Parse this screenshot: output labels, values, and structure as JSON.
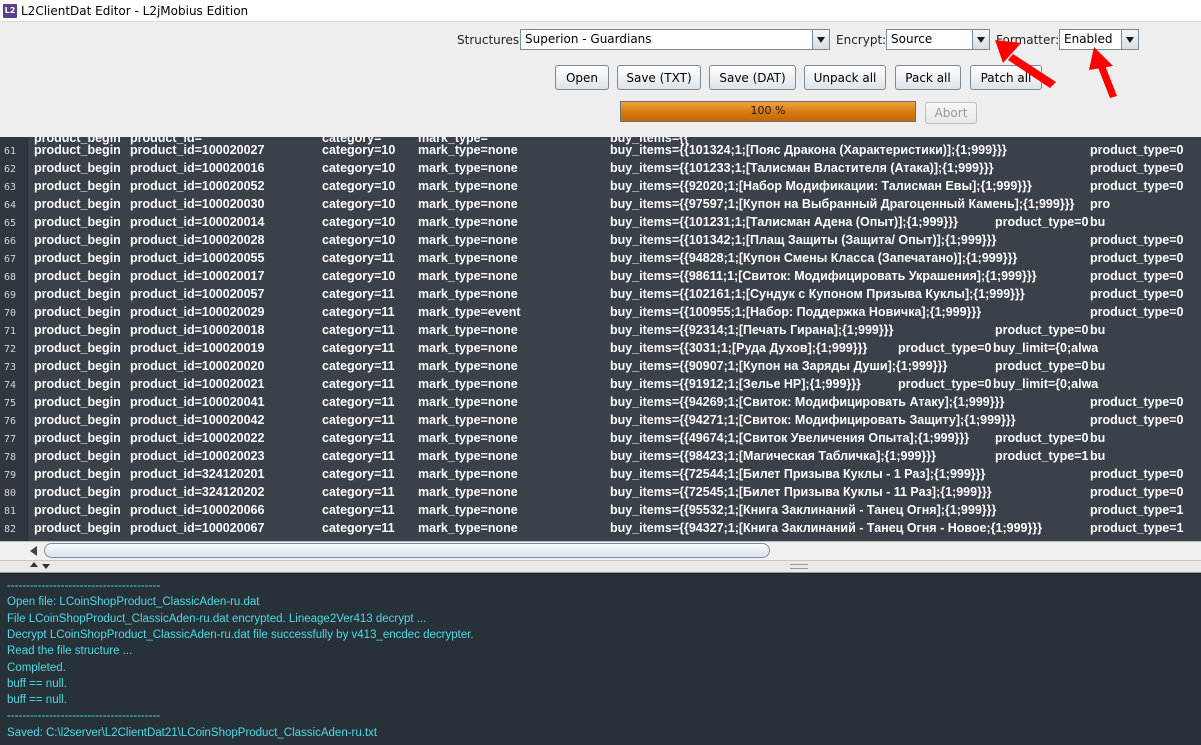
{
  "window": {
    "title": "L2ClientDat Editor - L2jMobius Edition",
    "icon_name": "l2-app-icon",
    "icon_text": "L2"
  },
  "toolbar": {
    "structures_label": "Structures",
    "structures_value": "Superion - Guardians",
    "encrypt_label": "Encrypt:",
    "encrypt_value": "Source",
    "formatter_label": "Formatter:",
    "formatter_value": "Enabled",
    "buttons": {
      "open": "Open",
      "save_txt": "Save (TXT)",
      "save_dat": "Save (DAT)",
      "unpack_all": "Unpack all",
      "pack_all": "Pack all",
      "patch_all": "Patch all",
      "abort": "Abort"
    },
    "progress_text": "100 %",
    "progress_value": 1.0,
    "progress_color": "#d6780d",
    "annotation_color": "#ff0000"
  },
  "editor": {
    "background": "#3a4149",
    "lines": [
      {
        "n": "61",
        "a": "product_begin",
        "b": "product_id=100020027",
        "c": "category=10",
        "d": "mark_type=none",
        "e": "buy_items={{101324;1;[Пояс Дракона (Характеристики)];{1;999}}}",
        "f": "product_type=0",
        "g": ""
      },
      {
        "n": "62",
        "a": "product_begin",
        "b": "product_id=100020016",
        "c": "category=10",
        "d": "mark_type=none",
        "e": "buy_items={{101233;1;[Талисман Властителя (Атака)];{1;999}}}",
        "f": "product_type=0",
        "g": ""
      },
      {
        "n": "63",
        "a": "product_begin",
        "b": "product_id=100020052",
        "c": "category=10",
        "d": "mark_type=none",
        "e": "buy_items={{92020;1;[Набор Модификации: Талисман Евы];{1;999}}}",
        "f": "product_type=0",
        "g": ""
      },
      {
        "n": "64",
        "a": "product_begin",
        "b": "product_id=100020030",
        "c": "category=10",
        "d": "mark_type=none",
        "e": "buy_items={{97597;1;[Купон на Выбранный Драгоценный Камень];{1;999}}}",
        "f": "",
        "g": "pro"
      },
      {
        "n": "65",
        "a": "product_begin",
        "b": "product_id=100020014",
        "c": "category=10",
        "d": "mark_type=none",
        "e": "buy_items={{101231;1;[Талисман Адена (Опыт)];{1;999}}}",
        "f": "product_type=0",
        "g": "bu"
      },
      {
        "n": "66",
        "a": "product_begin",
        "b": "product_id=100020028",
        "c": "category=10",
        "d": "mark_type=none",
        "e": "buy_items={{101342;1;[Плащ Защиты (Защита/ Опыт)];{1;999}}}",
        "f": "product_type=0",
        "g": ""
      },
      {
        "n": "67",
        "a": "product_begin",
        "b": "product_id=100020055",
        "c": "category=11",
        "d": "mark_type=none",
        "e": "buy_items={{94828;1;[Купон Смены Класса (Запечатано)];{1;999}}}",
        "f": "product_type=0",
        "g": ""
      },
      {
        "n": "68",
        "a": "product_begin",
        "b": "product_id=100020017",
        "c": "category=10",
        "d": "mark_type=none",
        "e": "buy_items={{98611;1;[Свиток: Модифицировать Украшения];{1;999}}}",
        "f": "product_type=0",
        "g": ""
      },
      {
        "n": "69",
        "a": "product_begin",
        "b": "product_id=100020057",
        "c": "category=11",
        "d": "mark_type=none",
        "e": "buy_items={{102161;1;[Сундук с Купоном Призыва Куклы];{1;999}}}",
        "f": "product_type=0",
        "g": ""
      },
      {
        "n": "70",
        "a": "product_begin",
        "b": "product_id=100020029",
        "c": "category=11",
        "d": "mark_type=event",
        "e": "buy_items={{100955;1;[Набор: Поддержка Новичка];{1;999}}}",
        "f": "product_type=0",
        "g": ""
      },
      {
        "n": "71",
        "a": "product_begin",
        "b": "product_id=100020018",
        "c": "category=11",
        "d": "mark_type=none",
        "e": "buy_items={{92314;1;[Печать Гирана];{1;999}}}",
        "f": "product_type=0",
        "g": "bu"
      },
      {
        "n": "72",
        "a": "product_begin",
        "b": "product_id=100020019",
        "c": "category=11",
        "d": "mark_type=none",
        "e": "buy_items={{3031;1;[Руда Духов];{1;999}}}",
        "f": "product_type=0",
        "g": "buy_limit={0;alwa"
      },
      {
        "n": "73",
        "a": "product_begin",
        "b": "product_id=100020020",
        "c": "category=11",
        "d": "mark_type=none",
        "e": "buy_items={{90907;1;[Купон на Заряды Души];{1;999}}}",
        "f": "product_type=0",
        "g": "bu"
      },
      {
        "n": "74",
        "a": "product_begin",
        "b": "product_id=100020021",
        "c": "category=11",
        "d": "mark_type=none",
        "e": "buy_items={{91912;1;[Зелье HP];{1;999}}}",
        "f": "product_type=0",
        "g": "buy_limit={0;alwa"
      },
      {
        "n": "75",
        "a": "product_begin",
        "b": "product_id=100020041",
        "c": "category=11",
        "d": "mark_type=none",
        "e": "buy_items={{94269;1;[Свиток: Модифицировать Атаку];{1;999}}}",
        "f": "product_type=0",
        "g": ""
      },
      {
        "n": "76",
        "a": "product_begin",
        "b": "product_id=100020042",
        "c": "category=11",
        "d": "mark_type=none",
        "e": "buy_items={{94271;1;[Свиток: Модифицировать Защиту];{1;999}}}",
        "f": "product_type=0",
        "g": ""
      },
      {
        "n": "77",
        "a": "product_begin",
        "b": "product_id=100020022",
        "c": "category=11",
        "d": "mark_type=none",
        "e": "buy_items={{49674;1;[Свиток Увеличения Опыта];{1;999}}}",
        "f": "product_type=0",
        "g": "bu"
      },
      {
        "n": "78",
        "a": "product_begin",
        "b": "product_id=100020023",
        "c": "category=11",
        "d": "mark_type=none",
        "e": "buy_items={{98423;1;[Магическая Табличка];{1;999}}}",
        "f": "product_type=1",
        "g": "bu"
      },
      {
        "n": "79",
        "a": "product_begin",
        "b": "product_id=324120201",
        "c": "category=11",
        "d": "mark_type=none",
        "e": "buy_items={{72544;1;[Билет Призыва Куклы - 1 Раз];{1;999}}}",
        "f": "product_type=0",
        "g": ""
      },
      {
        "n": "80",
        "a": "product_begin",
        "b": "product_id=324120202",
        "c": "category=11",
        "d": "mark_type=none",
        "e": "buy_items={{72545;1;[Билет Призыва Куклы - 11 Раз];{1;999}}}",
        "f": "product_type=0",
        "g": ""
      },
      {
        "n": "81",
        "a": "product_begin",
        "b": "product_id=100020066",
        "c": "category=11",
        "d": "mark_type=none",
        "e": "buy_items={{95532;1;[Книга Заклинаний - Танец Огня];{1;999}}}",
        "f": "product_type=1",
        "g": ""
      },
      {
        "n": "82",
        "a": "product_begin",
        "b": "product_id=100020067",
        "c": "category=11",
        "d": "mark_type=none",
        "e": "buy_items={{94327;1;[Книга Заклинаний - Танец Огня - Новое;{1;999}}}",
        "f": "product_type=1",
        "g": ""
      }
    ]
  },
  "console": {
    "text_color": "#4fd8e6",
    "lines": [
      "----------------------------------------",
      "Open file: LCoinShopProduct_ClassicAden-ru.dat",
      "File LCoinShopProduct_ClassicAden-ru.dat encrypted. Lineage2Ver413 decrypt ...",
      "Decrypt LCoinShopProduct_ClassicAden-ru.dat file successfully by v413_encdec decrypter.",
      "Read the file structure ...",
      "Completed.",
      "buff == null.",
      "buff == null.",
      "----------------------------------------",
      "Saved: C:\\l2server\\L2ClientDat21\\LCoinShopProduct_ClassicAden-ru.txt"
    ]
  }
}
